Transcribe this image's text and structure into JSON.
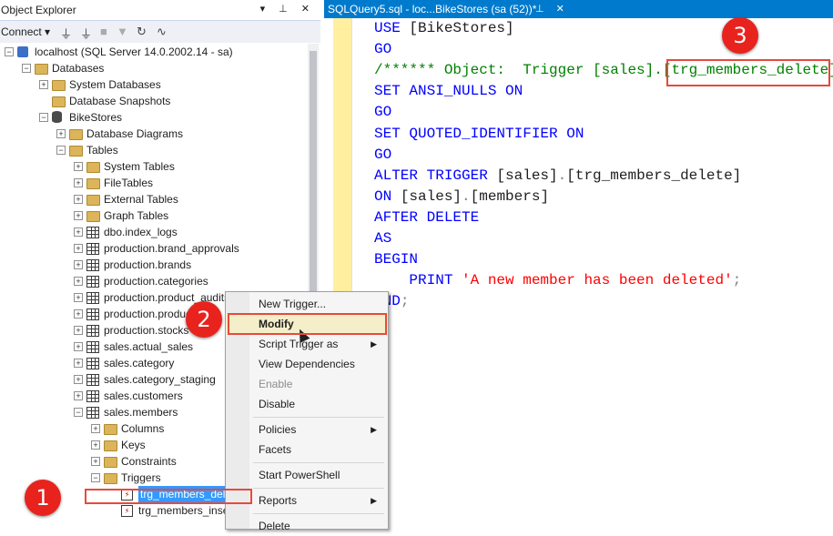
{
  "object_explorer": {
    "title": "Object Explorer",
    "title_buttons": "▾ ⊥ ✕",
    "toolbar": {
      "connect_label": "Connect ▾",
      "icons": [
        "connect-icon",
        "disconnect-icon",
        "stop-icon",
        "filter-icon",
        "refresh-icon",
        "activity-icon"
      ]
    },
    "tree": [
      {
        "label": "localhost (SQL Server 14.0.2002.14 - sa)",
        "icon": "server",
        "state": "minus",
        "level": 0
      },
      {
        "label": "Databases",
        "icon": "folder",
        "state": "minus",
        "level": 1
      },
      {
        "label": "System Databases",
        "icon": "folder",
        "state": "plus",
        "level": 2
      },
      {
        "label": "Database Snapshots",
        "icon": "folder",
        "state": "none",
        "level": 2
      },
      {
        "label": "BikeStores",
        "icon": "db",
        "state": "minus",
        "level": 2
      },
      {
        "label": "Database Diagrams",
        "icon": "folder",
        "state": "plus",
        "level": 3
      },
      {
        "label": "Tables",
        "icon": "folder",
        "state": "minus",
        "level": 3
      },
      {
        "label": "System Tables",
        "icon": "folder",
        "state": "plus",
        "level": 4
      },
      {
        "label": "FileTables",
        "icon": "folder",
        "state": "plus",
        "level": 4
      },
      {
        "label": "External Tables",
        "icon": "folder",
        "state": "plus",
        "level": 4
      },
      {
        "label": "Graph Tables",
        "icon": "folder",
        "state": "plus",
        "level": 4
      },
      {
        "label": "dbo.index_logs",
        "icon": "table",
        "state": "plus",
        "level": 4
      },
      {
        "label": "production.brand_approvals",
        "icon": "table",
        "state": "plus",
        "level": 4
      },
      {
        "label": "production.brands",
        "icon": "table",
        "state": "plus",
        "level": 4
      },
      {
        "label": "production.categories",
        "icon": "table",
        "state": "plus",
        "level": 4
      },
      {
        "label": "production.product_audits",
        "icon": "table",
        "state": "plus",
        "level": 4
      },
      {
        "label": "production.products",
        "icon": "table",
        "state": "plus",
        "level": 4
      },
      {
        "label": "production.stocks",
        "icon": "table",
        "state": "plus",
        "level": 4
      },
      {
        "label": "sales.actual_sales",
        "icon": "table",
        "state": "plus",
        "level": 4
      },
      {
        "label": "sales.category",
        "icon": "table",
        "state": "plus",
        "level": 4
      },
      {
        "label": "sales.category_staging",
        "icon": "table",
        "state": "plus",
        "level": 4
      },
      {
        "label": "sales.customers",
        "icon": "table",
        "state": "plus",
        "level": 4
      },
      {
        "label": "sales.members",
        "icon": "table",
        "state": "minus",
        "level": 4
      },
      {
        "label": "Columns",
        "icon": "folder",
        "state": "plus",
        "level": 5
      },
      {
        "label": "Keys",
        "icon": "folder",
        "state": "plus",
        "level": 5
      },
      {
        "label": "Constraints",
        "icon": "folder",
        "state": "plus",
        "level": 5
      },
      {
        "label": "Triggers",
        "icon": "folder",
        "state": "minus",
        "level": 5
      },
      {
        "label": "trg_members_delete",
        "icon": "trig",
        "state": "none",
        "level": 6,
        "selected": true
      },
      {
        "label": "trg_members_insert",
        "icon": "trig",
        "state": "none",
        "level": 6
      }
    ]
  },
  "editor": {
    "tab_title": "SQLQuery5.sql - loc...BikeStores (sa (52))*",
    "tab_buttons": "⊥ ✕",
    "lines": [
      [
        [
          "kw",
          "USE "
        ],
        [
          "pl",
          "[BikeStores]"
        ]
      ],
      [
        [
          "kw",
          "GO"
        ]
      ],
      [
        [
          "cm",
          "/****** Object:  Trigger [sales].[trg_members_delete]"
        ]
      ],
      [
        [
          "kw",
          "SET "
        ],
        [
          "kw",
          "ANSI_NULLS "
        ],
        [
          "kw",
          "ON"
        ]
      ],
      [
        [
          "kw",
          "GO"
        ]
      ],
      [
        [
          "kw",
          "SET "
        ],
        [
          "kw",
          "QUOTED_IDENTIFIER "
        ],
        [
          "kw",
          "ON"
        ]
      ],
      [
        [
          "kw",
          "GO"
        ]
      ],
      [
        [
          "kw",
          "ALTER TRIGGER "
        ],
        [
          "pl",
          "[sales]"
        ],
        [
          "gr",
          "."
        ],
        [
          "pl",
          "[trg_members_delete]"
        ]
      ],
      [
        [
          "kw",
          "ON "
        ],
        [
          "pl",
          "[sales]"
        ],
        [
          "gr",
          "."
        ],
        [
          "pl",
          "[members]"
        ]
      ],
      [
        [
          "kw",
          "AFTER DELETE"
        ]
      ],
      [
        [
          "kw",
          "AS"
        ]
      ],
      [
        [
          "kw",
          "BEGIN"
        ]
      ],
      [
        [
          "pl",
          "    "
        ],
        [
          "kw",
          "PRINT "
        ],
        [
          "st",
          "'A new member has been deleted'"
        ],
        [
          "gr",
          ";"
        ]
      ],
      [
        [
          "kw",
          "END"
        ],
        [
          "gr",
          ";"
        ]
      ]
    ]
  },
  "context_menu": {
    "items": [
      {
        "label": "New Trigger...",
        "type": "item"
      },
      {
        "label": "Modify",
        "type": "item",
        "highlight": true
      },
      {
        "label": "Script Trigger as",
        "type": "item",
        "submenu": true
      },
      {
        "label": "View Dependencies",
        "type": "item"
      },
      {
        "label": "Enable",
        "type": "item",
        "disabled": true
      },
      {
        "label": "Disable",
        "type": "item"
      },
      {
        "type": "sep"
      },
      {
        "label": "Policies",
        "type": "item",
        "submenu": true
      },
      {
        "label": "Facets",
        "type": "item"
      },
      {
        "type": "sep"
      },
      {
        "label": "Start PowerShell",
        "type": "item"
      },
      {
        "type": "sep"
      },
      {
        "label": "Reports",
        "type": "item",
        "submenu": true
      },
      {
        "type": "sep"
      },
      {
        "label": "Delete",
        "type": "item"
      }
    ]
  },
  "annotations": {
    "badge_1": "1",
    "badge_2": "2",
    "badge_3": "3"
  },
  "colors": {
    "accent": "#007acc",
    "badge": "#e8231d",
    "keyword": "#0000ff",
    "comment": "#008000",
    "string": "#ff0000"
  }
}
